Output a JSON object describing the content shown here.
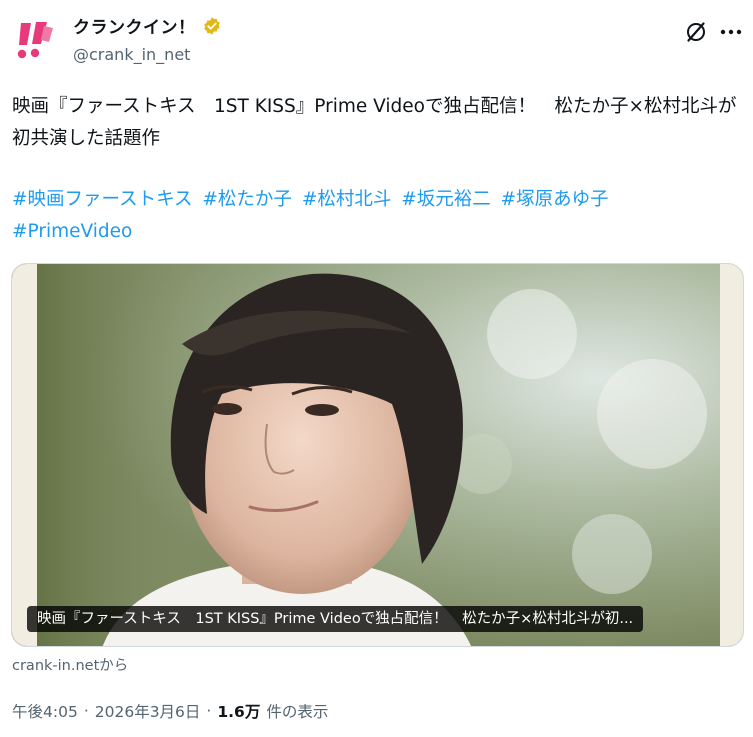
{
  "account": {
    "display_name": "クランクイン！",
    "handle": "@crank_in_net",
    "avatar_icon": "crankin-logo-icon",
    "verified_icon": "verified-badge-icon",
    "brand_color": "#e8397d",
    "verified_color": "#e2b719"
  },
  "actions": {
    "grok_icon": "grok-icon",
    "more_icon": "more-icon"
  },
  "post": {
    "text": "映画『ファーストキス　1ST KISS』Prime Videoで独占配信！　松たか子×松村北斗が初共演した話題作",
    "hashtags": [
      "#映画ファーストキス",
      "#松たか子",
      "#松村北斗",
      "#坂元裕二",
      "#塚原あゆ子",
      "#PrimeVideo"
    ],
    "link_color": "#1d9bf0"
  },
  "card": {
    "title": "映画『ファーストキス　1ST KISS』Prime Videoで独占配信！　松たか子×松村北斗が初...",
    "source": "crank-in.netから"
  },
  "meta": {
    "time": "午後4:05",
    "separator": "·",
    "date": "2026年3月6日",
    "views": "1.6万",
    "views_label": "件の表示"
  }
}
